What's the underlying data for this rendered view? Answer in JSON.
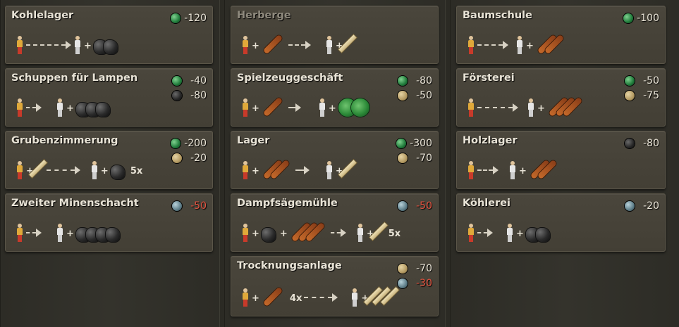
{
  "icons": {
    "worker_red": "worker-red-icon",
    "worker_white": "worker-white-icon",
    "coal": "coal-icon",
    "log": "log-icon",
    "plank": "plank-icon",
    "coin": "coin-icon"
  },
  "columns": [
    {
      "cards": [
        {
          "title": "Kohlelager",
          "costs": [
            {
              "type": "green",
              "value": "-120"
            }
          ]
        },
        {
          "title": "Schuppen für Lampen",
          "costs": [
            {
              "type": "green",
              "value": "-40"
            },
            {
              "type": "coal",
              "value": "-80"
            }
          ]
        },
        {
          "title": "Grubenzimmerung",
          "costs": [
            {
              "type": "green",
              "value": "-200"
            },
            {
              "type": "plank",
              "value": "-20"
            }
          ],
          "multiplier": "5x"
        },
        {
          "title": "Zweiter Minenschacht",
          "costs": [
            {
              "type": "tool",
              "value": "-50"
            }
          ]
        }
      ]
    },
    {
      "cards": [
        {
          "title": "Herberge",
          "costs": []
        },
        {
          "title": "Spielzeuggeschäft",
          "costs": [
            {
              "type": "green",
              "value": "-80"
            },
            {
              "type": "plank",
              "value": "-50"
            }
          ]
        },
        {
          "title": "Lager",
          "costs": [
            {
              "type": "green",
              "value": "-300"
            },
            {
              "type": "plank",
              "value": "-70"
            }
          ]
        },
        {
          "title": "Dampfsägemühle",
          "costs": [
            {
              "type": "tool",
              "value": "-50"
            }
          ],
          "multiplier": "5x"
        },
        {
          "title": "Trocknungsanlage",
          "costs": [
            {
              "type": "plank",
              "value": "-70"
            },
            {
              "type": "tool",
              "value": "-30"
            }
          ],
          "multiplier": "4x"
        }
      ]
    },
    {
      "cards": [
        {
          "title": "Baumschule",
          "costs": [
            {
              "type": "green",
              "value": "-100"
            }
          ]
        },
        {
          "title": "Försterei",
          "costs": [
            {
              "type": "green",
              "value": "-50"
            },
            {
              "type": "plank",
              "value": "-75"
            }
          ]
        },
        {
          "title": "Holzlager",
          "costs": [
            {
              "type": "coal",
              "value": "-80"
            }
          ]
        },
        {
          "title": "Köhlerei",
          "costs": [
            {
              "type": "tool",
              "value": "-20"
            }
          ]
        }
      ]
    }
  ]
}
